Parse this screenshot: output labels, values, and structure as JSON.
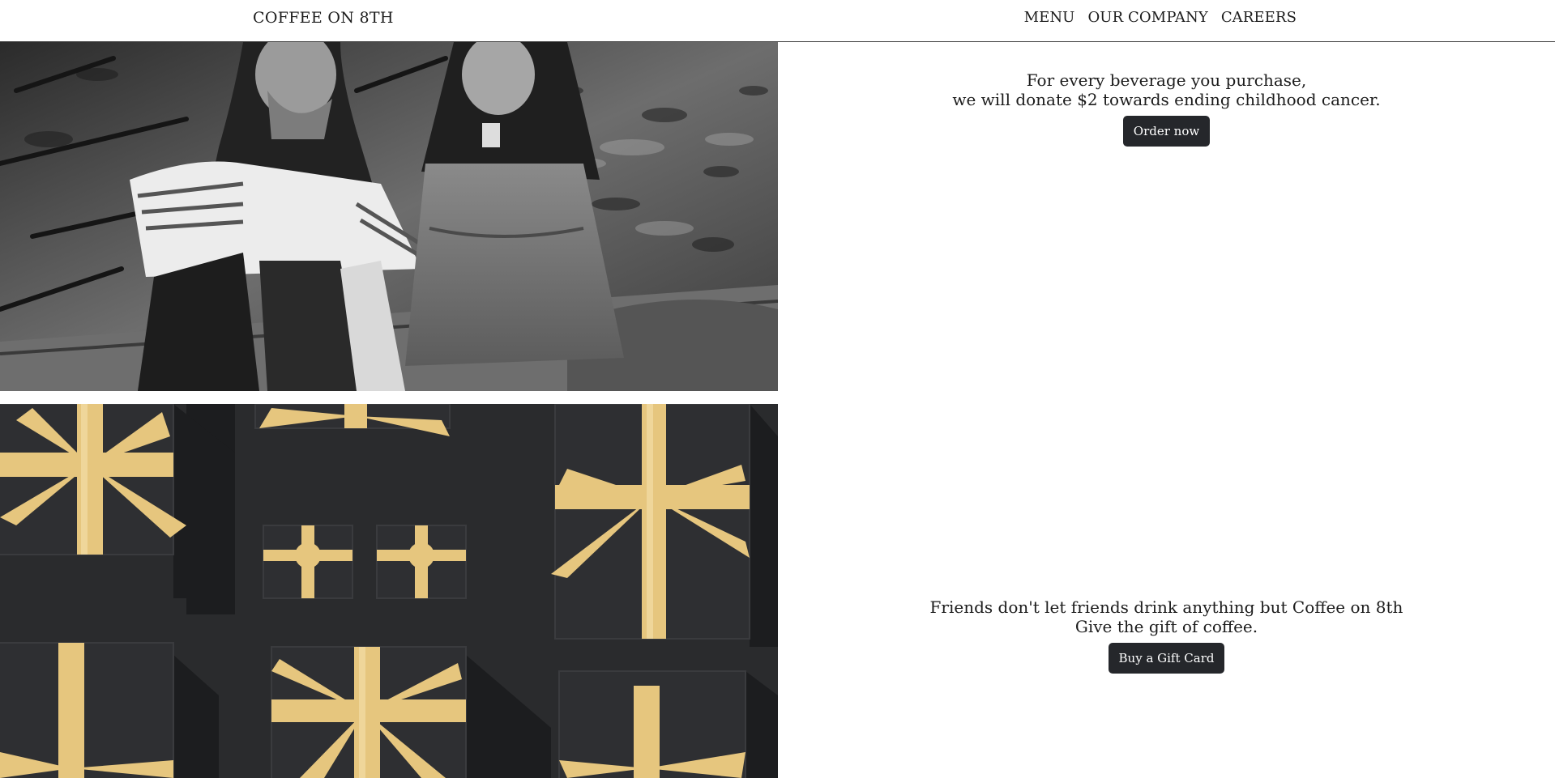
{
  "header": {
    "brand": "COFFEE ON 8TH",
    "nav": [
      {
        "label": "MENU"
      },
      {
        "label": "OUR COMPANY"
      },
      {
        "label": "CAREERS"
      }
    ]
  },
  "donation_section": {
    "line1": "For every beverage you purchase,",
    "line2": "we will donate $2 towards ending childhood cancer.",
    "button_label": "Order now"
  },
  "gift_section": {
    "line1": "Friends don't let friends drink anything but Coffee on 8th",
    "line2": "Give the gift of coffee.",
    "button_label": "Buy a Gift Card"
  },
  "colors": {
    "button_bg": "#25272b",
    "ribbon_gold": "#e6c67e",
    "gift_box": "#2a2b2d",
    "header_border": "#3a3a3a"
  }
}
